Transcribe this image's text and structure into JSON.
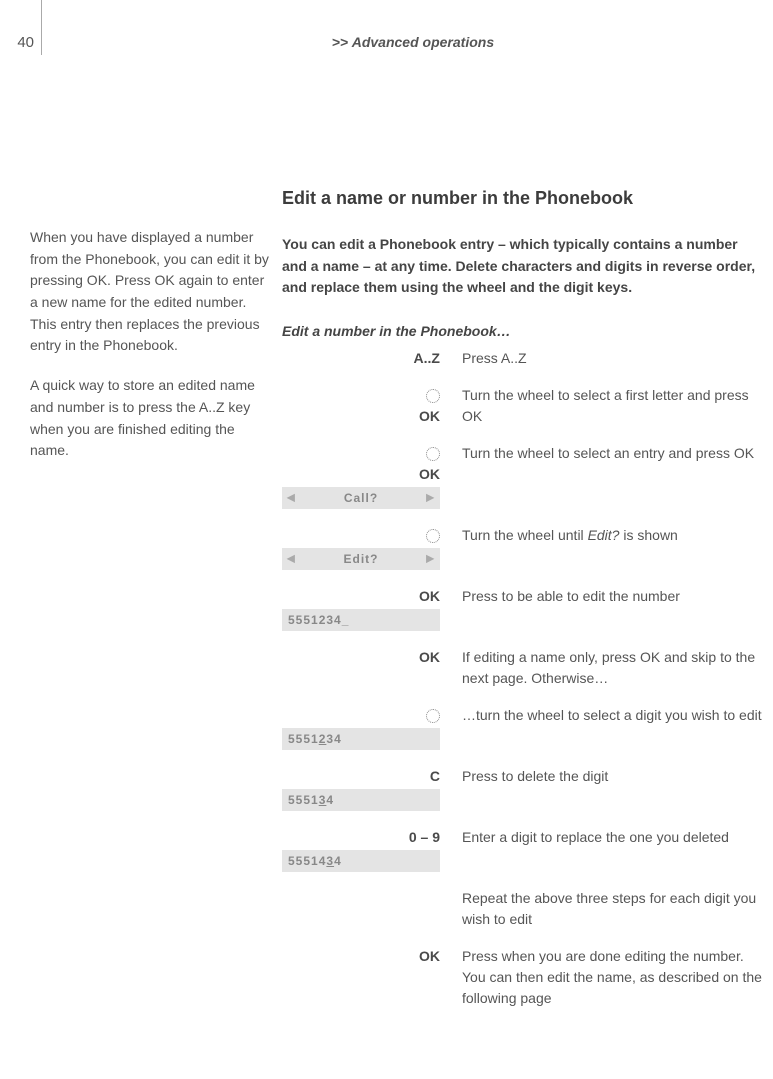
{
  "page_number": "40",
  "running_head_prefix": ">>",
  "running_head": "Advanced operations",
  "sidebar": {
    "p1": "When you have displayed a number from the Phonebook, you can edit it by pressing OK. Press OK again to enter a new name for the edited number. This entry then replaces the previous entry in the Phonebook.",
    "p2": "A quick way to store an edited name and number is to press the A..Z key when you are finished editing the name."
  },
  "main": {
    "heading": "Edit a name or number in the Phonebook",
    "intro": "You can edit a Phonebook entry – which typically contains a number and a name – at any time. Delete characters and digits in reverse order, and replace them using the wheel and the digit keys.",
    "section_title": "Edit a number in the Phonebook…",
    "steps": [
      {
        "key": "A..Z",
        "desc": "Press A..Z"
      },
      {
        "key_type": "wheel_ok",
        "ok": "OK",
        "desc": "Turn the wheel to select a first letter and press OK"
      },
      {
        "key_type": "wheel_ok_lcd",
        "ok": "OK",
        "lcd": "Call?",
        "desc": "Turn the wheel to select an entry and press OK"
      },
      {
        "key_type": "wheel_lcd",
        "lcd": "Edit?",
        "desc_pre": "Turn the wheel until ",
        "desc_em": "Edit?",
        "desc_post": " is shown"
      },
      {
        "key_type": "ok_num",
        "ok": "OK",
        "num_pre": "5551234",
        "num_u": "",
        "num_post": "",
        "cursor": "_",
        "desc": "Press to be able to edit the number"
      },
      {
        "key": "OK",
        "desc": "If editing a name only, press OK and skip to the next page. Otherwise…"
      },
      {
        "key_type": "wheel_num",
        "num_pre": "5551",
        "num_u": "2",
        "num_post": "34",
        "desc": "…turn the wheel to select a digit you wish to edit"
      },
      {
        "key_type": "key_num",
        "key": "C",
        "num_pre": "5551",
        "num_u": "3",
        "num_post": "4",
        "desc": "Press to delete the digit"
      },
      {
        "key_type": "key_num",
        "key": "0 – 9",
        "num_pre": "55514",
        "num_u": "3",
        "num_post": "4",
        "desc": "Enter a digit to replace the one you deleted"
      },
      {
        "key_type": "desc_only",
        "desc": "Repeat the above three steps for each digit you wish to edit"
      },
      {
        "key": "OK",
        "desc": "Press when you are done editing the number. You can then edit the name, as described on the following page"
      }
    ]
  }
}
